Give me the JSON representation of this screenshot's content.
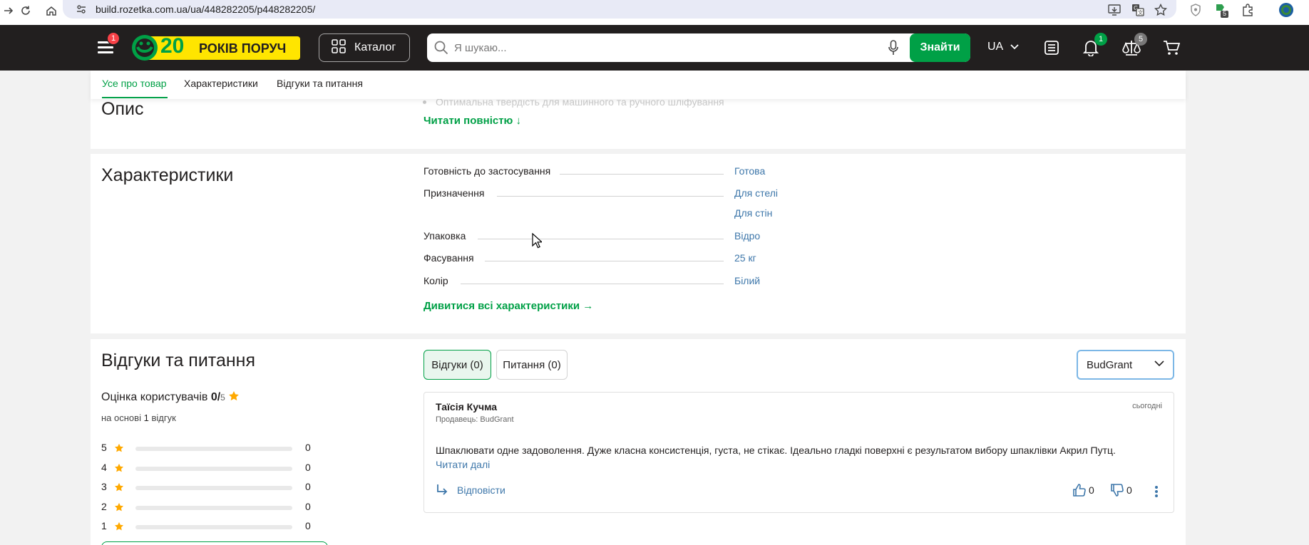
{
  "browser": {
    "url": "build.rozetka.com.ua/ua/448282205/p448282205/",
    "extensions_badge": "5"
  },
  "header": {
    "menu_badge": "1",
    "logo_number": "20",
    "logo_text": "РОКІВ ПОРУЧ",
    "catalog_label": "Каталог",
    "search_placeholder": "Я шукаю...",
    "search_button": "Знайти",
    "language": "UA",
    "notifications_badge": "1",
    "compare_badge": "5"
  },
  "tabs": {
    "items": [
      "Усе про товар",
      "Характеристики",
      "Відгуки та питання"
    ],
    "active_index": 0
  },
  "description": {
    "title": "Опис",
    "faded_bullet": "Оптимальна твердість для машинного та ручного шліфування",
    "read_more": "Читати повністю ↓"
  },
  "characteristics": {
    "title": "Характеристики",
    "rows": [
      {
        "label": "Готовність до застосування",
        "values": [
          "Готова"
        ]
      },
      {
        "label": "Призначення",
        "values": [
          "Для стелі",
          "Для стін"
        ]
      },
      {
        "label": "Упаковка",
        "values": [
          "Відро"
        ]
      },
      {
        "label": "Фасування",
        "values": [
          "25 кг"
        ]
      },
      {
        "label": "Колір",
        "values": [
          "Білий"
        ]
      }
    ],
    "see_all": "Дивитися всі характеристики →"
  },
  "reviews": {
    "title": "Відгуки та питання",
    "tab_reviews": "Відгуки (0)",
    "tab_questions": "Питання (0)",
    "seller_filter": "BudGrant",
    "rating_label": "Оцінка користувачів",
    "rating_value": "0/",
    "rating_max": "5",
    "based_on_prefix": "на основі",
    "based_on_count": "1",
    "based_on_suffix": "відгук",
    "distribution": [
      {
        "stars": "5",
        "count": "0",
        "fraction": 0
      },
      {
        "stars": "4",
        "count": "0",
        "fraction": 0
      },
      {
        "stars": "3",
        "count": "0",
        "fraction": 0
      },
      {
        "stars": "2",
        "count": "0",
        "fraction": 0
      },
      {
        "stars": "1",
        "count": "0",
        "fraction": 0
      }
    ],
    "items": [
      {
        "author": "Таїсія Кучма",
        "seller": "Продавець: BudGrant",
        "date": "сьогодні",
        "text": "Шпаклювати одне задоволення. Дуже класна консистенція, густа, не стікає. Ідеально гладкі поверхні є результатом вибору шпаклівки Акрил Путц.",
        "read_more": "Читати далі",
        "reply_label": "Відповісти",
        "likes": "0",
        "dislikes": "0"
      }
    ]
  },
  "colors": {
    "header_bg": "#221f1f",
    "brand_green": "#00a046",
    "link_blue": "#3e77aa",
    "badge_red": "#f84147",
    "star_yellow": "#ffa900",
    "logo_yellow": "#ffe500"
  }
}
